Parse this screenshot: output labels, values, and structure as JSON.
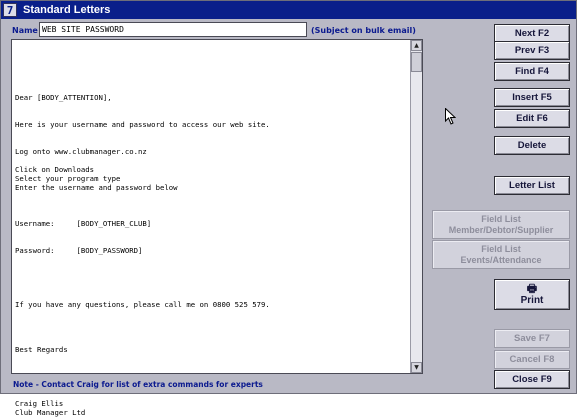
{
  "window": {
    "title": "Standard Letters",
    "icon": "app-7-icon",
    "icon_glyph": "7"
  },
  "form": {
    "name_label": "Name",
    "name_value": "WEB SITE PASSWORD",
    "subject_note": "(Subject on bulk email)"
  },
  "letter_lines": [
    "Dear [BODY_ATTENTION],",
    "",
    "",
    "Here is your username and password to access our web site.",
    "",
    "",
    "Log onto www.clubmanager.co.nz",
    "",
    "Click on Downloads",
    "Select your program type",
    "Enter the username and password below",
    "",
    "",
    "",
    "Username:     [BODY_OTHER_CLUB]",
    "",
    "",
    "Password:     [BODY_PASSWORD]",
    "",
    "",
    "",
    "",
    "",
    "If you have any questions, please call me on 0800 525 579.",
    "",
    "",
    "",
    "",
    "Best Regards",
    "",
    "",
    "",
    "",
    "",
    "Craig Ellis",
    "Club Manager Ltd"
  ],
  "footer_note": "Note - Contact Craig for list of extra commands for experts",
  "buttons": {
    "next": "Next F2",
    "prev": "Prev F3",
    "find": "Find F4",
    "insert": "Insert F5",
    "edit": "Edit F6",
    "delete": "Delete",
    "letter_list": "Letter List",
    "field_list_member_line1": "Field List",
    "field_list_member_line2": "Member/Debtor/Supplier",
    "field_list_events_line1": "Field List",
    "field_list_events_line2": "Events/Attendance",
    "print": "Print",
    "save": "Save F7",
    "cancel": "Cancel F8",
    "close": "Close F9"
  },
  "icons": {
    "printer": "printer-icon",
    "scroll_up": "arrow-up-icon",
    "scroll_down": "arrow-down-icon",
    "cursor": "mouse-pointer-icon"
  },
  "colors": {
    "titlebar": "#0a1f8a",
    "window_bg": "#b9b9c5",
    "label_text": "#0b1a8f",
    "disabled_text": "#8e8e9c"
  }
}
